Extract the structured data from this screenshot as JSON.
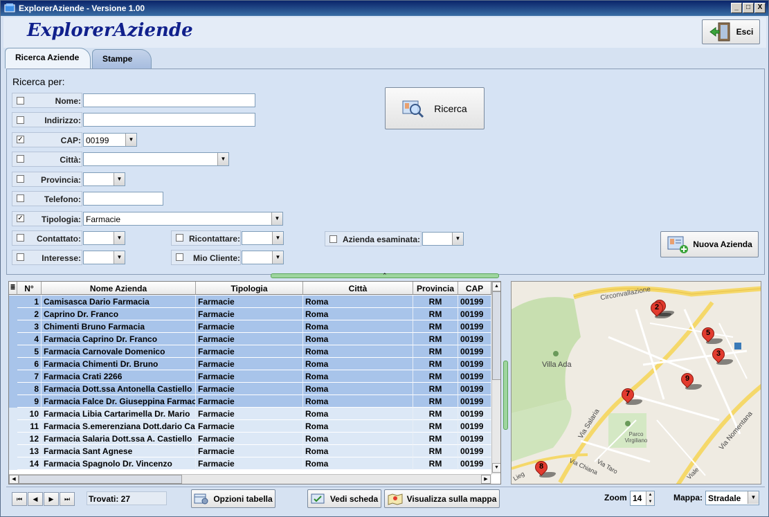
{
  "window": {
    "title": "ExplorerAziende  -  Versione 1.00",
    "minimize": "_",
    "maximize": "□",
    "close": "X"
  },
  "header": {
    "app_title": "ExplorerAziende",
    "exit_label": "Esci"
  },
  "tabs": [
    {
      "label": "Ricerca Aziende",
      "active": true
    },
    {
      "label": "Stampe",
      "active": false
    }
  ],
  "search": {
    "section_label": "Ricerca per:",
    "search_button": "Ricerca",
    "new_company_button": "Nuova Azienda",
    "fields": {
      "nome": {
        "label": "Nome:",
        "checked": false,
        "value": ""
      },
      "indirizzo": {
        "label": "Indirizzo:",
        "checked": false,
        "value": ""
      },
      "cap": {
        "label": "CAP:",
        "checked": true,
        "value": "00199"
      },
      "citta": {
        "label": "Città:",
        "checked": false,
        "value": ""
      },
      "provincia": {
        "label": "Provincia:",
        "checked": false,
        "value": ""
      },
      "telefono": {
        "label": "Telefono:",
        "checked": false,
        "value": ""
      },
      "tipologia": {
        "label": "Tipologia:",
        "checked": true,
        "value": "Farmacie"
      },
      "contattato": {
        "label": "Contattato:",
        "checked": false,
        "value": ""
      },
      "interesse": {
        "label": "Interesse:",
        "checked": false,
        "value": ""
      },
      "ricontattare": {
        "label": "Ricontattare:",
        "checked": false,
        "value": ""
      },
      "mio_cliente": {
        "label": "Mio Cliente:",
        "checked": false,
        "value": ""
      },
      "azienda_esaminata": {
        "label": "Azienda esaminata:",
        "checked": false,
        "value": ""
      }
    }
  },
  "table": {
    "columns": [
      "N°",
      "Nome Azienda",
      "Tipologia",
      "Città",
      "Provincia",
      "CAP"
    ],
    "rows": [
      {
        "n": "1",
        "nome": "Camisasca Dario Farmacia",
        "tipologia": "Farmacie",
        "citta": "Roma",
        "provincia": "RM",
        "cap": "00199",
        "selected": true
      },
      {
        "n": "2",
        "nome": "Caprino Dr. Franco",
        "tipologia": "Farmacie",
        "citta": "Roma",
        "provincia": "RM",
        "cap": "00199",
        "selected": true
      },
      {
        "n": "3",
        "nome": "Chimenti Bruno Farmacia",
        "tipologia": "Farmacie",
        "citta": "Roma",
        "provincia": "RM",
        "cap": "00199",
        "selected": true
      },
      {
        "n": "4",
        "nome": "Farmacia Caprino Dr. Franco",
        "tipologia": "Farmacie",
        "citta": "Roma",
        "provincia": "RM",
        "cap": "00199",
        "selected": true
      },
      {
        "n": "5",
        "nome": "Farmacia Carnovale Domenico",
        "tipologia": "Farmacie",
        "citta": "Roma",
        "provincia": "RM",
        "cap": "00199",
        "selected": true
      },
      {
        "n": "6",
        "nome": "Farmacia Chimenti Dr. Bruno",
        "tipologia": "Farmacie",
        "citta": "Roma",
        "provincia": "RM",
        "cap": "00199",
        "selected": true
      },
      {
        "n": "7",
        "nome": "Farmacia Crati 2266",
        "tipologia": "Farmacie",
        "citta": "Roma",
        "provincia": "RM",
        "cap": "00199",
        "selected": true
      },
      {
        "n": "8",
        "nome": "Farmacia Dott.ssa Antonella Castiello",
        "tipologia": "Farmacie",
        "citta": "Roma",
        "provincia": "RM",
        "cap": "00199",
        "selected": true
      },
      {
        "n": "9",
        "nome": "Farmacia Falce Dr. Giuseppina Farmac",
        "tipologia": "Farmacie",
        "citta": "Roma",
        "provincia": "RM",
        "cap": "00199",
        "selected": true
      },
      {
        "n": "10",
        "nome": "Farmacia Libia Cartarimella Dr. Mario",
        "tipologia": "Farmacie",
        "citta": "Roma",
        "provincia": "RM",
        "cap": "00199",
        "selected": false
      },
      {
        "n": "11",
        "nome": "Farmacia S.emerenziana Dott.dario Ca",
        "tipologia": "Farmacie",
        "citta": "Roma",
        "provincia": "RM",
        "cap": "00199",
        "selected": false
      },
      {
        "n": "12",
        "nome": "Farmacia Salaria Dott.ssa A. Castiello",
        "tipologia": "Farmacie",
        "citta": "Roma",
        "provincia": "RM",
        "cap": "00199",
        "selected": false
      },
      {
        "n": "13",
        "nome": "Farmacia Sant Agnese",
        "tipologia": "Farmacie",
        "citta": "Roma",
        "provincia": "RM",
        "cap": "00199",
        "selected": false
      },
      {
        "n": "14",
        "nome": "Farmacia Spagnolo Dr. Vincenzo",
        "tipologia": "Farmacie",
        "citta": "Roma",
        "provincia": "RM",
        "cap": "00199",
        "selected": false
      }
    ]
  },
  "footer": {
    "found_label": "Trovati: 27",
    "table_options": "Opzioni tabella",
    "view_card": "Vedi scheda",
    "view_map": "Visualizza sulla mappa",
    "zoom_label": "Zoom",
    "zoom_value": "14",
    "map_label": "Mappa:",
    "map_type": "Stradale"
  },
  "map": {
    "labels": {
      "circonvallazione": "Circonvallazione",
      "villa_ada": "Villa Ada",
      "via_salaria": "Via Salaria",
      "via_nomentana": "Via Nomentana",
      "parco": "Parco Virgiliano",
      "via_chiana": "Via Chiana",
      "via_taro": "Via Taro",
      "viale": "Viale",
      "lieg": "Lieg"
    },
    "pins": [
      "1",
      "2",
      "3",
      "5",
      "7",
      "8",
      "9"
    ]
  },
  "colors": {
    "title_bar": "#0a246a",
    "app_title": "#10208c",
    "selected_row": "#a8c4ea",
    "pin": "#e23b2e"
  }
}
